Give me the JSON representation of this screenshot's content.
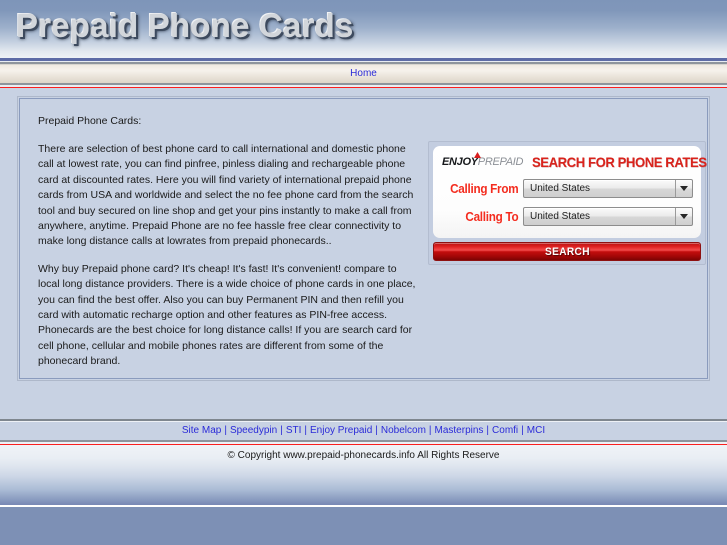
{
  "site": {
    "title": "Prepaid Phone Cards"
  },
  "nav": {
    "items": [
      {
        "label": "Home",
        "name": "nav-item-home"
      }
    ]
  },
  "main": {
    "lead": "Prepaid Phone Cards:",
    "paragraphs": [
      "There are selection of best phone card to call international and domestic phone call at lowest rate, you can find pinfree, pinless dialing and rechargeable phone card at discounted rates. Here you will find variety of international prepaid phone cards from USA and worldwide and select the no fee phone card from the search tool and buy secured on line shop and get your pins instantly to make a call from anywhere, anytime. Prepaid Phone are no fee hassle free clear connectivity to make long distance calls at lowrates from prepaid phonecards..",
      "Why buy Prepaid phone card? It's cheap! It's fast! It's convenient! compare to local long distance providers. There is a wide choice of phone cards in one place, you can find the best offer. Also you can buy Permanent PIN and then refill you card with automatic recharge option and other features as PIN-free access. Phonecards are the best choice for long distance calls! If you are search card for cell phone, cellular and mobile phones rates are different from some of the phonecard brand."
    ]
  },
  "widget": {
    "logo": {
      "bold_part": "ENJOY",
      "light_part": "PREPAID"
    },
    "title": "SEARCH FOR PHONE RATES",
    "fields": [
      {
        "label": "Calling From",
        "value": "United States",
        "name": "calling-from"
      },
      {
        "label": "Calling To",
        "value": "United States",
        "name": "calling-to"
      }
    ],
    "search_button": "SEARCH",
    "colors": {
      "accent_red": "#d9231c",
      "label_red": "#f42c1f",
      "button_red": "#c30d0d"
    }
  },
  "footer": {
    "links": [
      "Site Map",
      "Speedypin",
      "STI",
      "Enjoy Prepaid",
      "Nobelcom",
      "Masterpins",
      "Comfi",
      "MCI"
    ],
    "separator": "|",
    "copyright": "© Copyright www.prepaid-phonecards.info All Rights Reserve"
  },
  "theme": {
    "page_background": "#c8d2e3",
    "header_blue": "#7e95b9",
    "link_blue": "#2b2bd8",
    "rule_red": "#fa1f1f"
  }
}
